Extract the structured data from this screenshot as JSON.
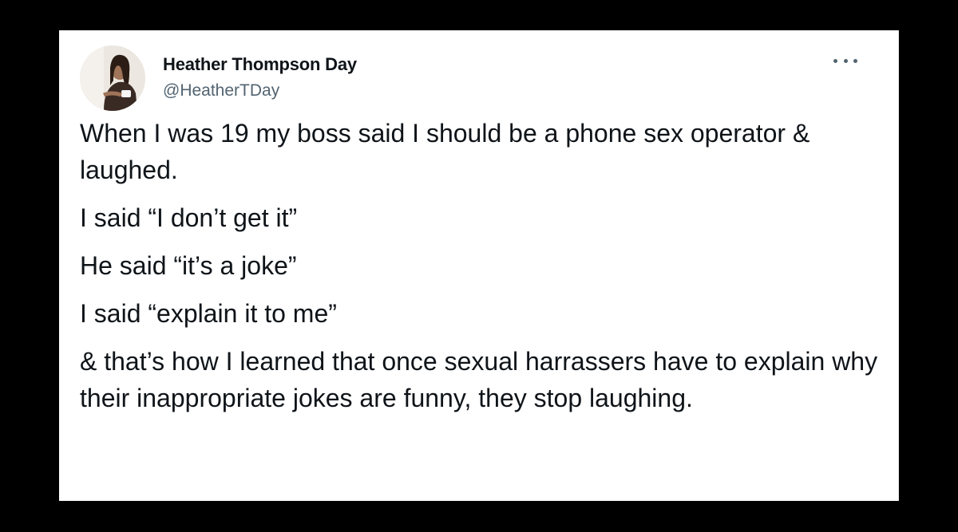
{
  "tweet": {
    "author_name": "Heather Thompson Day",
    "author_handle": "@HeatherTDay",
    "avatar_icon": "profile-photo",
    "more_icon": "more-horizontal-icon",
    "paragraphs": [
      "When I was 19 my boss said I should be a phone sex operator & laughed.",
      "I said “I don’t get it”",
      "He said “it’s a joke”",
      "I said “explain it to me”",
      "& that’s how I learned that once sexual harrassers have to explain why their inappropriate jokes are funny, they stop laughing."
    ]
  },
  "colors": {
    "background": "#000000",
    "card": "#ffffff",
    "text_primary": "#0f1419",
    "text_secondary": "#536471"
  }
}
